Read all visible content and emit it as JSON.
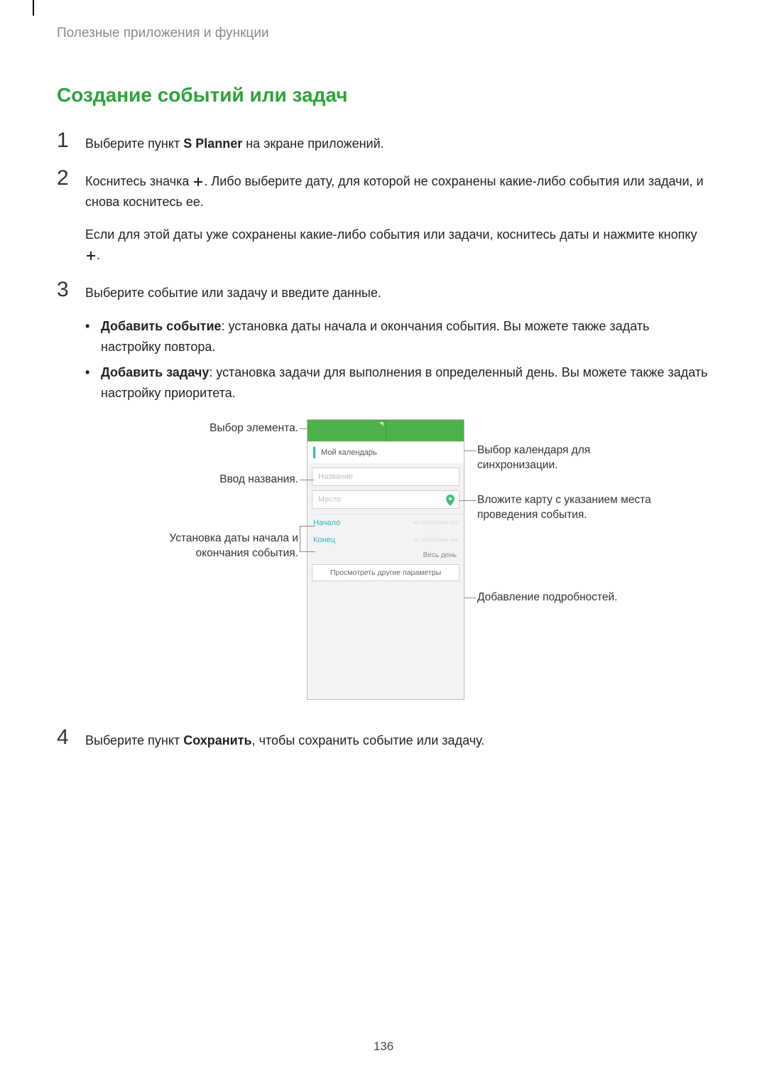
{
  "chapter": "Полезные приложения и функции",
  "h2": "Создание событий или задач",
  "steps": {
    "s1": {
      "num": "1",
      "pre": "Выберите пункт ",
      "bold": "S Planner",
      "post": " на экране приложений."
    },
    "s2": {
      "num": "2",
      "pre": "Коснитесь значка ",
      "post": ". Либо выберите дату, для которой не сохранены какие-либо события или задачи, и снова коснитесь ее.",
      "after_pre": "Если для этой даты уже сохранены какие-либо события или задачи, коснитесь даты и нажмите кнопку ",
      "after_post": "."
    },
    "s3": {
      "num": "3",
      "text": "Выберите событие или задачу и введите данные."
    },
    "s4": {
      "num": "4",
      "pre": "Выберите пункт ",
      "bold": "Сохранить",
      "post": ", чтобы сохранить событие или задачу."
    }
  },
  "bullets": {
    "b1": {
      "label": "Добавить событие",
      "text": ": установка даты начала и окончания события. Вы можете также задать настройку повтора."
    },
    "b2": {
      "label": "Добавить задачу",
      "text": ": установка задачи для выполнения в определенный день. Вы можете также задать настройку приоритета."
    }
  },
  "callouts": {
    "left1": "Выбор элемента.",
    "left2": "Ввод названия.",
    "left3a": "Установка даты начала и",
    "left3b": "окончания события.",
    "right1a": "Выбор календаря для",
    "right1b": "синхронизации.",
    "right2a": "Вложите карту с указанием места",
    "right2b": "проведения события.",
    "right3": "Добавление подробностей."
  },
  "phone": {
    "calendar": "Мой календарь",
    "name_placeholder": "Название",
    "place_placeholder": "Место",
    "start": "Начало",
    "end": "Конец",
    "allday": "Весь день",
    "more": "Просмотреть другие параметры"
  },
  "page_number": "136"
}
